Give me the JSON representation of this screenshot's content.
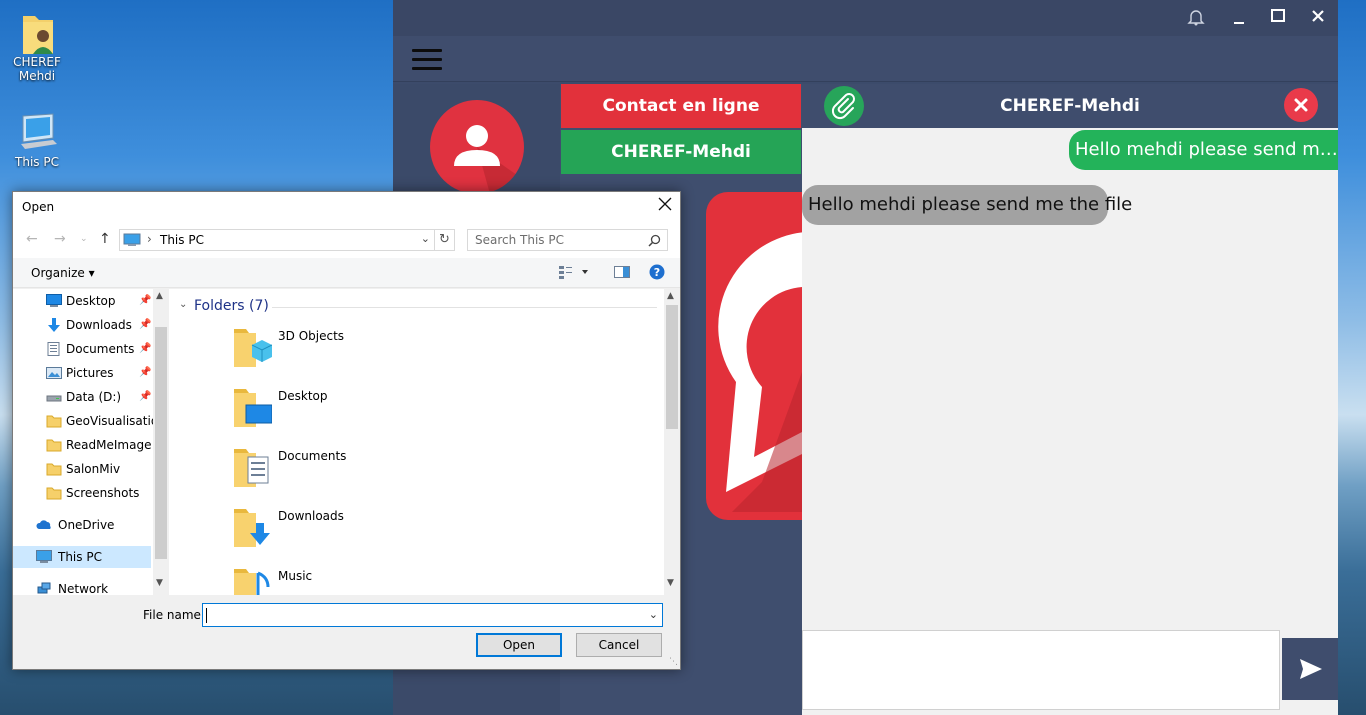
{
  "desktop": {
    "icons": [
      {
        "label_line1": "CHEREF",
        "label_line2": "Mehdi",
        "icon": "user-folder-icon"
      },
      {
        "label_line1": "This PC",
        "label_line2": "",
        "icon": "computer-icon"
      }
    ]
  },
  "app": {
    "contact_button": "Contact en ligne",
    "user_button": "CHEREF-Mehdi",
    "chat": {
      "title": "CHEREF-Mehdi",
      "messages": [
        {
          "type": "sent",
          "text": "Hello mehdi please send me the file"
        },
        {
          "type": "received",
          "text": "Hello mehdi please send me the file"
        }
      ],
      "input_value": ""
    },
    "colors": {
      "red": "#e2313b",
      "green": "#25a456",
      "navy": "#3c4b6b"
    }
  },
  "dialog": {
    "title": "Open",
    "address_location": "This PC",
    "search_placeholder": "Search This PC",
    "organize_label": "Organize",
    "nav_items": [
      {
        "label": "Desktop",
        "pinned": true,
        "icon": "desktop-icon"
      },
      {
        "label": "Downloads",
        "pinned": true,
        "icon": "download-icon"
      },
      {
        "label": "Documents",
        "pinned": true,
        "icon": "documents-icon"
      },
      {
        "label": "Pictures",
        "pinned": true,
        "icon": "pictures-icon"
      },
      {
        "label": "Data (D:)",
        "pinned": true,
        "icon": "drive-icon"
      },
      {
        "label": "GeoVisualisation",
        "pinned": false,
        "icon": "folder-icon"
      },
      {
        "label": "ReadMeImage",
        "pinned": false,
        "icon": "folder-icon"
      },
      {
        "label": "SalonMiv",
        "pinned": false,
        "icon": "folder-icon"
      },
      {
        "label": "Screenshots",
        "pinned": false,
        "icon": "folder-icon"
      },
      {
        "label": "OneDrive",
        "pinned": false,
        "icon": "onedrive-icon"
      },
      {
        "label": "This PC",
        "pinned": false,
        "icon": "computer-icon"
      },
      {
        "label": "Network",
        "pinned": false,
        "icon": "network-icon"
      }
    ],
    "group_header": "Folders (7)",
    "folders": [
      {
        "label": "3D Objects",
        "icon": "3d-objects-folder-icon"
      },
      {
        "label": "Desktop",
        "icon": "desktop-folder-icon"
      },
      {
        "label": "Documents",
        "icon": "documents-folder-icon"
      },
      {
        "label": "Downloads",
        "icon": "downloads-folder-icon"
      },
      {
        "label": "Music",
        "icon": "music-folder-icon"
      }
    ],
    "file_name_label": "File name:",
    "file_name_value": "",
    "open_button": "Open",
    "cancel_button": "Cancel"
  }
}
